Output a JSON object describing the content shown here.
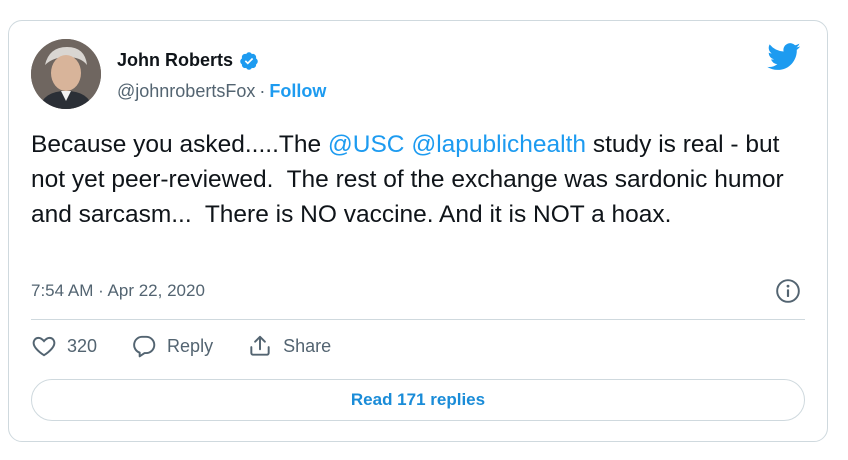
{
  "author": {
    "name": "John Roberts",
    "handle": "@johnrobertsFox",
    "separator": "·",
    "follow_label": "Follow",
    "verified": true
  },
  "tweet": {
    "segments": [
      {
        "text": "Because you asked.....The ",
        "type": "text"
      },
      {
        "text": "@USC",
        "type": "mention"
      },
      {
        "text": " ",
        "type": "text"
      },
      {
        "text": "@lapublichealth",
        "type": "mention"
      },
      {
        "text": " study is real - but not yet peer-reviewed.  The rest of the exchange was sardonic humor and sarcasm...  There is NO vaccine. And it is NOT a hoax.",
        "type": "text"
      }
    ],
    "timestamp": "7:54 AM · Apr 22, 2020"
  },
  "actions": {
    "like_count": "320",
    "reply_label": "Reply",
    "share_label": "Share"
  },
  "read_replies_label": "Read 171 replies",
  "colors": {
    "accent": "#1d9bf0",
    "text": "#0f1419",
    "muted": "#536471",
    "border": "#cfd9de"
  },
  "icons": {
    "brand": "twitter-bird-icon",
    "verified": "verified-badge-icon",
    "info": "info-icon",
    "like": "heart-icon",
    "reply": "speech-bubble-icon",
    "share": "share-upload-icon"
  }
}
